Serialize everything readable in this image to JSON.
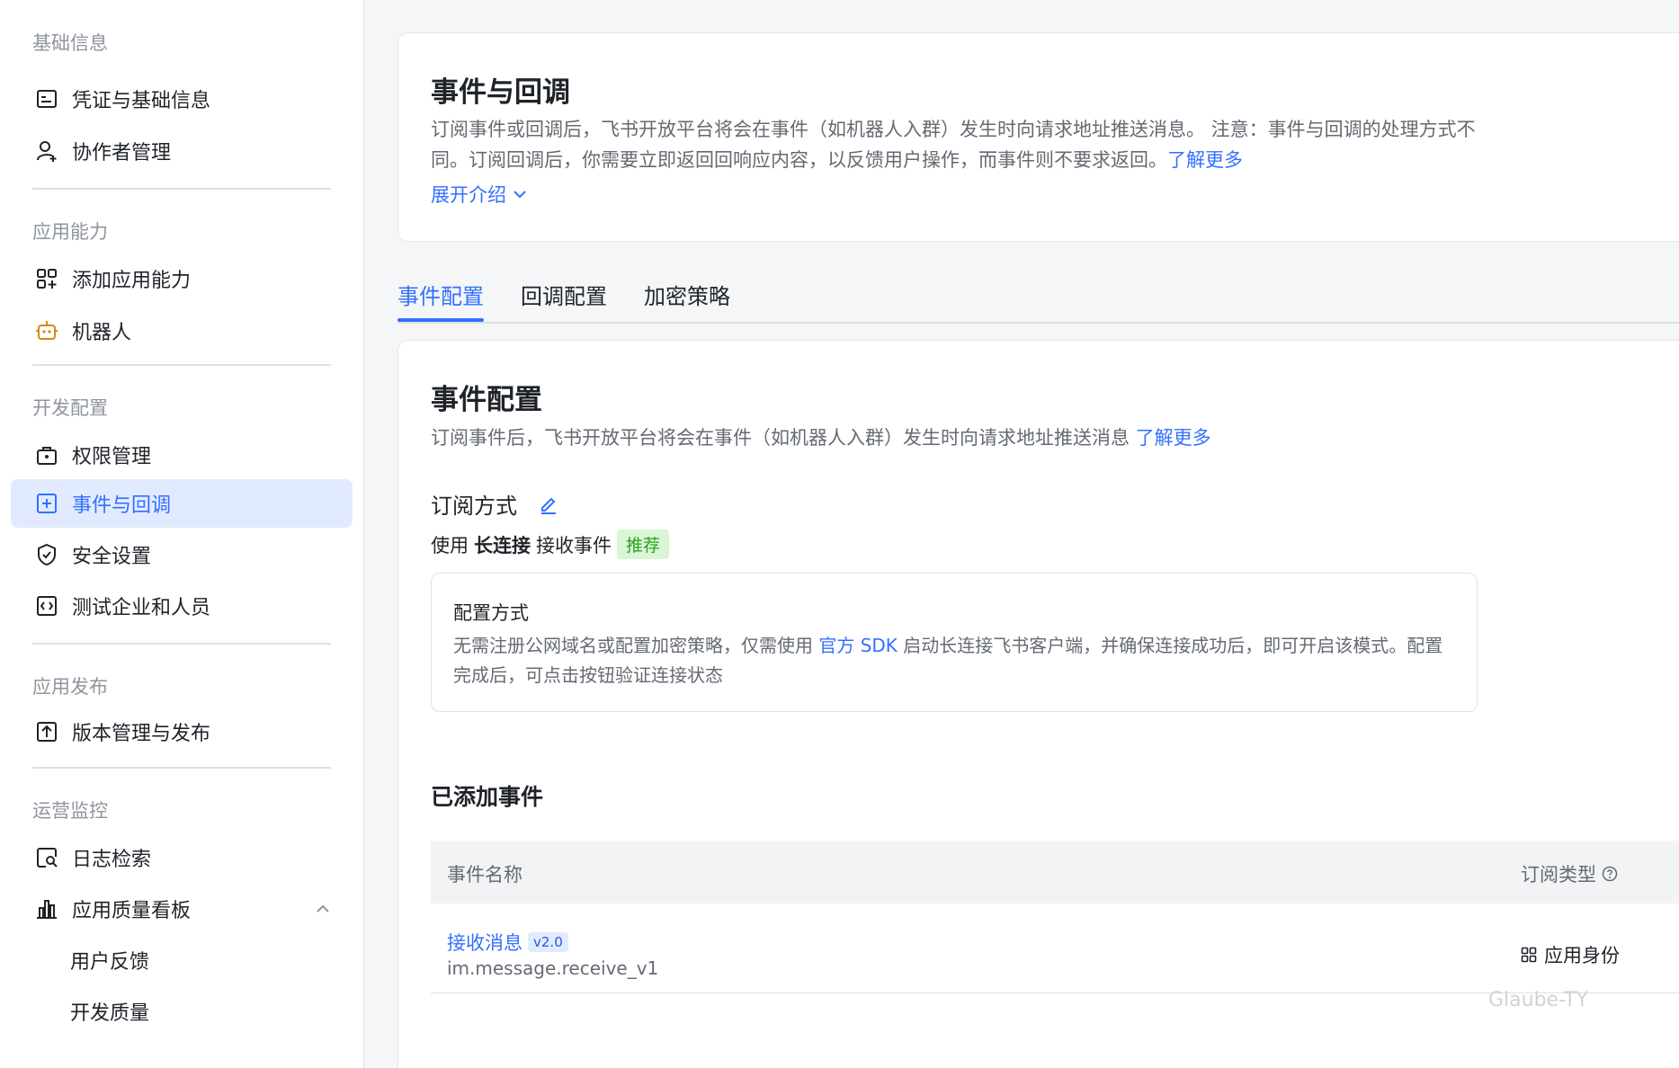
{
  "sidebar": {
    "groups": [
      {
        "title": "基础信息"
      },
      {
        "title": "应用能力"
      },
      {
        "title": "开发配置"
      },
      {
        "title": "应用发布"
      },
      {
        "title": "运营监控"
      }
    ],
    "items": [
      {
        "label": "凭证与基础信息",
        "icon": "credential-icon"
      },
      {
        "label": "协作者管理",
        "icon": "add-user-icon"
      },
      {
        "label": "添加应用能力",
        "icon": "add-app-icon"
      },
      {
        "label": "机器人",
        "icon": "robot-icon"
      },
      {
        "label": "权限管理",
        "icon": "permission-icon"
      },
      {
        "label": "事件与回调",
        "icon": "event-icon"
      },
      {
        "label": "安全设置",
        "icon": "shield-icon"
      },
      {
        "label": "测试企业和人员",
        "icon": "code-icon"
      },
      {
        "label": "版本管理与发布",
        "icon": "upload-icon"
      },
      {
        "label": "日志检索",
        "icon": "log-search-icon"
      },
      {
        "label": "应用质量看板",
        "icon": "chart-icon"
      },
      {
        "label": "用户反馈"
      },
      {
        "label": "开发质量"
      }
    ],
    "active_index": 5,
    "colors": {
      "active_bg": "#e1eaff",
      "active_text": "#3370ff",
      "robot_icon": "#d8870c"
    }
  },
  "intro": {
    "title": "事件与回调",
    "desc": "订阅事件或回调后，飞书开放平台将会在事件（如机器人入群）发生时向请求地址推送消息。 注意：事件与回调的处理方式不同。订阅回调后，你需要立即返回回响应内容，以反馈用户操作，而事件则不要求返回。",
    "learn_more": "了解更多",
    "expand": "展开介绍"
  },
  "tabs": [
    {
      "label": "事件配置",
      "active": true
    },
    {
      "label": "回调配置",
      "active": false
    },
    {
      "label": "加密策略",
      "active": false
    }
  ],
  "event_config": {
    "title": "事件配置",
    "desc": "订阅事件后，飞书开放平台将会在事件（如机器人入群）发生时向请求地址推送消息",
    "learn_more": "了解更多",
    "subscription_label": "订阅方式",
    "use_prefix": "使用",
    "use_mode": "长连接",
    "use_suffix": "接收事件",
    "recommend_tag": "推荐",
    "config_box": {
      "title": "配置方式",
      "desc_part1": "无需注册公网域名或配置加密策略，仅需使用",
      "sdk_link": "官方 SDK",
      "desc_part2": "启动长连接飞书客户端，并确保连接成功后，即可开启该模式。配置完成后，可点击按钮验证连接状态"
    }
  },
  "added_events": {
    "title": "已添加事件",
    "columns": [
      "事件名称",
      "订阅类型"
    ],
    "rows": [
      {
        "name": "接收消息",
        "version": "v2.0",
        "key": "im.message.receive_v1",
        "type": "应用身份"
      }
    ]
  },
  "watermark": "Glaube-TY",
  "colors": {
    "accent": "#3370ff",
    "recommend_bg": "#d9f5d6",
    "recommend_text": "#2ea121"
  }
}
